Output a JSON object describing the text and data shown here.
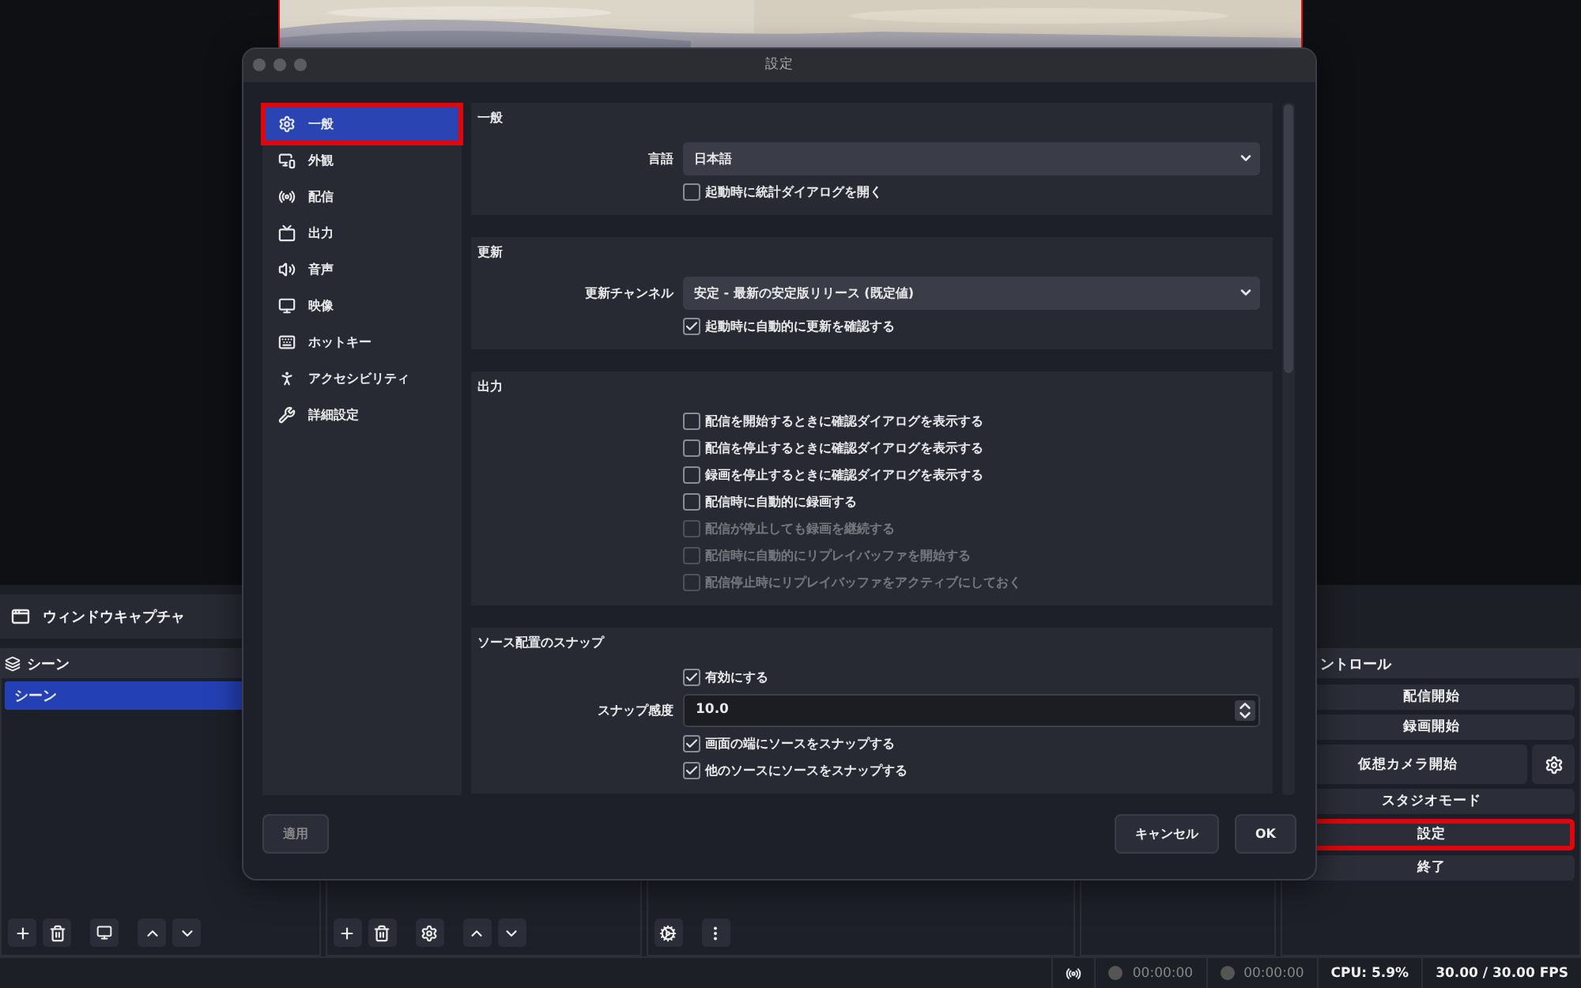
{
  "main": {
    "source_bar": {
      "label": "ウィンドウキャプチャ"
    },
    "scenes": {
      "title": "シーン",
      "items": [
        {
          "label": "シーン",
          "selected": true
        }
      ]
    },
    "controls": {
      "title": "ントロール",
      "buttons": [
        {
          "label": "配信開始",
          "kind": "plain",
          "highlighted": false
        },
        {
          "label": "録画開始",
          "kind": "plain",
          "highlighted": false
        },
        {
          "label": "仮想カメラ開始",
          "kind": "with-gear",
          "highlighted": false
        },
        {
          "label": "スタジオモード",
          "kind": "plain",
          "highlighted": false
        },
        {
          "label": "設定",
          "kind": "plain",
          "highlighted": true
        },
        {
          "label": "終了",
          "kind": "plain",
          "highlighted": false
        }
      ]
    },
    "status_bar": {
      "stream_time": "00:00:00",
      "record_time": "00:00:00",
      "cpu": "CPU: 5.9%",
      "fps": "30.00 / 30.00 FPS"
    }
  },
  "dialog": {
    "title": "設定",
    "sidebar": [
      {
        "label": "一般",
        "selected": true,
        "highlighted": true
      },
      {
        "label": "外観",
        "selected": false,
        "highlighted": false
      },
      {
        "label": "配信",
        "selected": false,
        "highlighted": false
      },
      {
        "label": "出力",
        "selected": false,
        "highlighted": false
      },
      {
        "label": "音声",
        "selected": false,
        "highlighted": false
      },
      {
        "label": "映像",
        "selected": false,
        "highlighted": false
      },
      {
        "label": "ホットキー",
        "selected": false,
        "highlighted": false
      },
      {
        "label": "アクセシビリティ",
        "selected": false,
        "highlighted": false
      },
      {
        "label": "詳細設定",
        "selected": false,
        "highlighted": false
      }
    ],
    "sections": [
      {
        "title": "一般",
        "rows": [
          {
            "kind": "select",
            "label": "言語",
            "value": "日本語"
          },
          {
            "kind": "checkbox",
            "label": "起動時に統計ダイアログを開く",
            "checked": false,
            "disabled": false
          }
        ]
      },
      {
        "title": "更新",
        "rows": [
          {
            "kind": "select",
            "label": "更新チャンネル",
            "value": "安定 - 最新の安定版リリース (既定値)"
          },
          {
            "kind": "checkbox",
            "label": "起動時に自動的に更新を確認する",
            "checked": true,
            "disabled": false
          }
        ]
      },
      {
        "title": "出力",
        "rows": [
          {
            "kind": "checkbox",
            "label": "配信を開始するときに確認ダイアログを表示する",
            "checked": false,
            "disabled": false
          },
          {
            "kind": "checkbox",
            "label": "配信を停止するときに確認ダイアログを表示する",
            "checked": false,
            "disabled": false
          },
          {
            "kind": "checkbox",
            "label": "録画を停止するときに確認ダイアログを表示する",
            "checked": false,
            "disabled": false
          },
          {
            "kind": "checkbox",
            "label": "配信時に自動的に録画する",
            "checked": false,
            "disabled": false
          },
          {
            "kind": "checkbox",
            "label": "配信が停止しても録画を継続する",
            "checked": false,
            "disabled": true
          },
          {
            "kind": "checkbox",
            "label": "配信時に自動的にリプレイバッファを開始する",
            "checked": false,
            "disabled": true
          },
          {
            "kind": "checkbox",
            "label": "配信停止時にリプレイバッファをアクティブにしておく",
            "checked": false,
            "disabled": true
          }
        ]
      },
      {
        "title": "ソース配置のスナップ",
        "rows": [
          {
            "kind": "checkbox",
            "label": "有効にする",
            "checked": true,
            "disabled": false
          },
          {
            "kind": "spin",
            "label": "スナップ感度",
            "value": "10.0"
          },
          {
            "kind": "checkbox",
            "label": "画面の端にソースをスナップする",
            "checked": true,
            "disabled": false
          },
          {
            "kind": "checkbox",
            "label": "他のソースにソースをスナップする",
            "checked": true,
            "disabled": false
          }
        ]
      }
    ],
    "buttons": {
      "apply": {
        "label": "適用",
        "disabled": true
      },
      "cancel": {
        "label": "キャンセル"
      },
      "ok": {
        "label": "OK"
      }
    }
  }
}
